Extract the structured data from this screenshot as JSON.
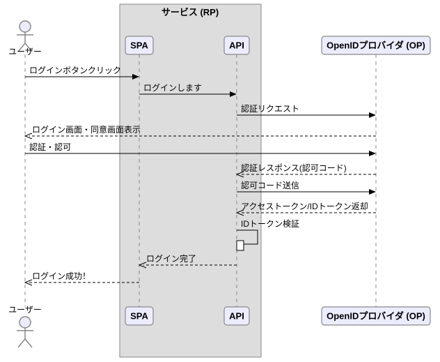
{
  "diagram_type": "sequence",
  "service_group": {
    "label": "サービス (RP)"
  },
  "participants": {
    "user": {
      "label": "ユーザー"
    },
    "spa": {
      "label": "SPA"
    },
    "api": {
      "label": "API"
    },
    "op": {
      "label": "OpenIDプロバイダ (OP)"
    }
  },
  "messages": {
    "m1": {
      "from": "user",
      "to": "spa",
      "label": "ログインボタンクリック"
    },
    "m2": {
      "from": "spa",
      "to": "api",
      "label": "ログインします"
    },
    "m3": {
      "from": "api",
      "to": "op",
      "label": "認証リクエスト"
    },
    "m4": {
      "from": "op",
      "to": "user",
      "label": "ログイン画面・同意画面表示",
      "dashed": true
    },
    "m5": {
      "from": "user",
      "to": "op",
      "label": "認証・認可"
    },
    "m6": {
      "from": "op",
      "to": "api",
      "label": "認証レスポンス(認可コード)",
      "dashed": true
    },
    "m7": {
      "from": "api",
      "to": "op",
      "label": "認可コード送信"
    },
    "m8": {
      "from": "op",
      "to": "api",
      "label": "アクセストークン/IDトークン返却",
      "dashed": true
    },
    "m9": {
      "from": "api",
      "to": "api",
      "label": "IDトークン検証"
    },
    "m10": {
      "from": "api",
      "to": "spa",
      "label": "ログイン完了",
      "dashed": true
    },
    "m11": {
      "from": "spa",
      "to": "user",
      "label": "ログイン成功！",
      "dashed": true
    }
  },
  "chart_data": {
    "type": "sequence-diagram",
    "group": {
      "name": "サービス (RP)",
      "members": [
        "SPA",
        "API"
      ]
    },
    "participants": [
      "ユーザー",
      "SPA",
      "API",
      "OpenIDプロバイダ (OP)"
    ],
    "steps": [
      {
        "from": "ユーザー",
        "to": "SPA",
        "text": "ログインボタンクリック",
        "return": false
      },
      {
        "from": "SPA",
        "to": "API",
        "text": "ログインします",
        "return": false
      },
      {
        "from": "API",
        "to": "OpenIDプロバイダ (OP)",
        "text": "認証リクエスト",
        "return": false
      },
      {
        "from": "OpenIDプロバイダ (OP)",
        "to": "ユーザー",
        "text": "ログイン画面・同意画面表示",
        "return": true
      },
      {
        "from": "ユーザー",
        "to": "OpenIDプロバイダ (OP)",
        "text": "認証・認可",
        "return": false
      },
      {
        "from": "OpenIDプロバイダ (OP)",
        "to": "API",
        "text": "認証レスポンス(認可コード)",
        "return": true
      },
      {
        "from": "API",
        "to": "OpenIDプロバイダ (OP)",
        "text": "認可コード送信",
        "return": false
      },
      {
        "from": "OpenIDプロバイダ (OP)",
        "to": "API",
        "text": "アクセストークン/IDトークン返却",
        "return": true
      },
      {
        "from": "API",
        "to": "API",
        "text": "IDトークン検証",
        "return": false
      },
      {
        "from": "API",
        "to": "SPA",
        "text": "ログイン完了",
        "return": true
      },
      {
        "from": "SPA",
        "to": "ユーザー",
        "text": "ログイン成功！",
        "return": true
      }
    ]
  }
}
